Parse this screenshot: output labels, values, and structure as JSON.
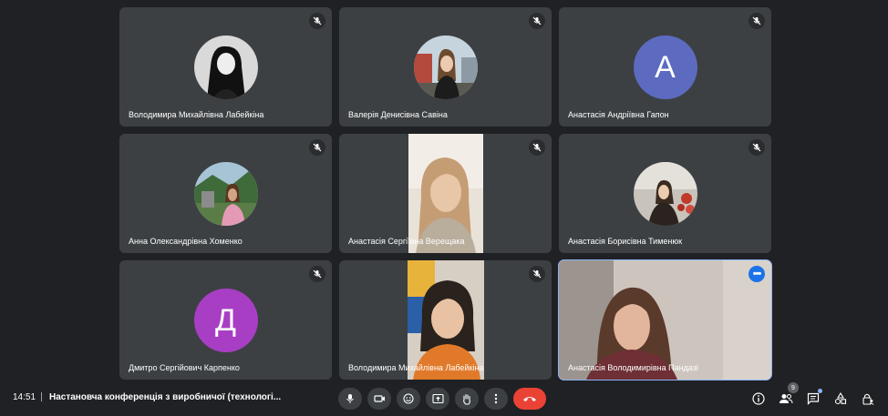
{
  "colors": {
    "tile_bg": "#3c4043",
    "page_bg": "#202124",
    "avatar_anastasia_hapon": "#5c6bc0",
    "avatar_dmytro_karpenko": "#a83ec4",
    "end_call": "#ea4335",
    "active_border": "#8ab4f8"
  },
  "participants": [
    {
      "name": "Володимира Михайлівна Лабейкіна",
      "muted": true
    },
    {
      "name": "Валерія Денисівна Савіна",
      "muted": true
    },
    {
      "name": "Анастасія Андріївна Гапон",
      "muted": true,
      "initial": "А"
    },
    {
      "name": "Анна Олександрівна Хоменко",
      "muted": true
    },
    {
      "name": "Анастасія Сергіївна Верещака",
      "muted": true
    },
    {
      "name": "Анастасія Борисівна Тименюк",
      "muted": true
    },
    {
      "name": "Дмитро Сергійович Карпенко",
      "muted": true,
      "initial": "Д"
    },
    {
      "name": "Володимира Михайлівна Лабейкіна",
      "muted": true
    },
    {
      "name": "Анастасія Володимирівна Пандазі",
      "muted": false
    }
  ],
  "bottom_bar": {
    "time": "14:51",
    "meeting_title": "Настановча конференція з виробничої (технологі...",
    "people_count": "9"
  }
}
